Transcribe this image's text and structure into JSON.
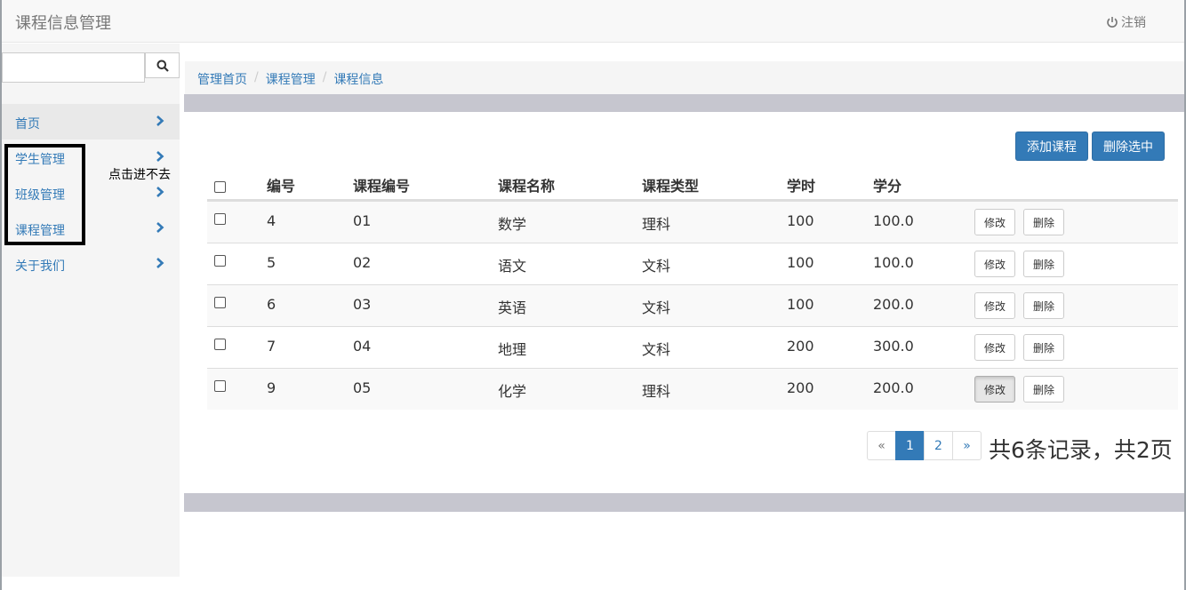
{
  "header": {
    "title": "课程信息管理",
    "logout_label": "注销"
  },
  "sidebar": {
    "search": {
      "value": "",
      "placeholder": ""
    },
    "items": [
      {
        "label": "首页"
      },
      {
        "label": "学生管理"
      },
      {
        "label": "班级管理"
      },
      {
        "label": "课程管理"
      },
      {
        "label": "关于我们"
      }
    ],
    "annotation": "点击进不去"
  },
  "breadcrumb": [
    "管理首页",
    "课程管理",
    "课程信息"
  ],
  "toolbar": {
    "add_label": "添加课程",
    "delete_selected_label": "删除选中"
  },
  "table": {
    "columns": [
      "编号",
      "课程编号",
      "课程名称",
      "课程类型",
      "学时",
      "学分"
    ],
    "rows": [
      [
        "4",
        "01",
        "数学",
        "理科",
        "100",
        "100.0"
      ],
      [
        "5",
        "02",
        "语文",
        "文科",
        "100",
        "100.0"
      ],
      [
        "6",
        "03",
        "英语",
        "文科",
        "100",
        "200.0"
      ],
      [
        "7",
        "04",
        "地理",
        "文科",
        "200",
        "300.0"
      ],
      [
        "9",
        "05",
        "化学",
        "理科",
        "200",
        "200.0"
      ]
    ],
    "edit_label": "修改",
    "delete_label": "删除"
  },
  "pagination": {
    "prev": "«",
    "pages": [
      "1",
      "2"
    ],
    "next": "»",
    "current": "1",
    "info": "共6条记录，共2页"
  },
  "colors": {
    "primary": "#337ab7",
    "band": "#c6c6cf"
  }
}
